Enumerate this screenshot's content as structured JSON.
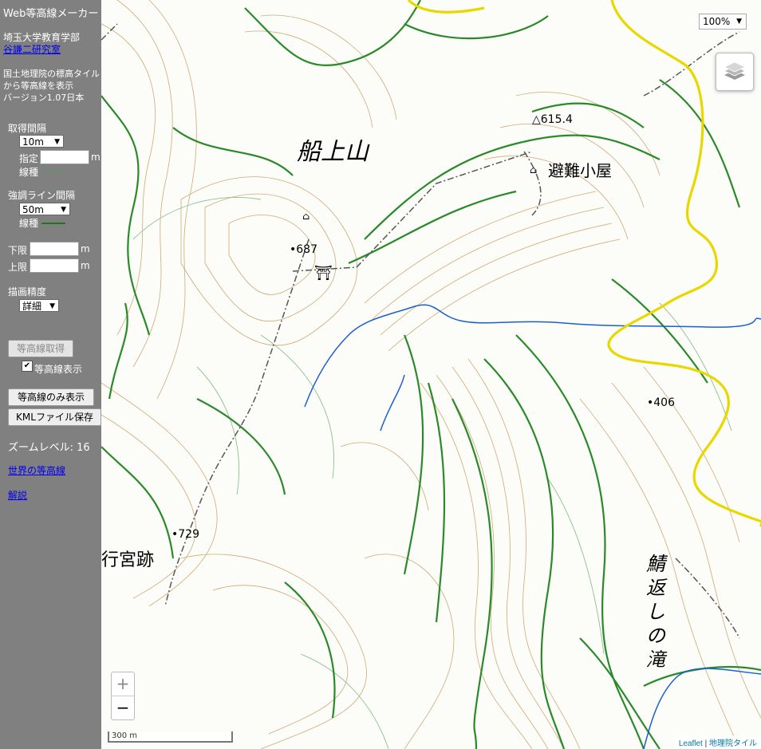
{
  "sidebar": {
    "app_title": "Web等高線メーカー",
    "org": "埼玉大学教育学部",
    "lab_link": "谷謙二研究室",
    "desc_line1": "国土地理院の標高タイル",
    "desc_line2": "から等高線を表示",
    "version": "バージョン1.07日本",
    "interval_label": "取得間隔",
    "interval_value": "10m",
    "custom_label": "指定",
    "unit_m": "m",
    "line_type_label": "線種",
    "emphasis_label": "強調ライン間隔",
    "emphasis_value": "50m",
    "lower_label": "下限",
    "upper_label": "上限",
    "precision_label": "描画精度",
    "precision_value": "詳細",
    "fetch_button": "等高線取得",
    "show_contours_label": "等高線表示",
    "contours_only_button": "等高線のみ表示",
    "kml_button": "KMLファイル保存",
    "zoom_level_text": "ズームレベル: 16",
    "world_link": "世界の等高線",
    "help_link": "解説",
    "colors": {
      "sidebar_bg": "#808080",
      "contour": "#2e8b57",
      "emphasis": "#1a7a1a"
    }
  },
  "map": {
    "labels": {
      "mountain": "船上山",
      "hut": "避難小屋",
      "peak_615": "△615.4",
      "spot_687": "687",
      "spot_729": "729",
      "spot_406": "406",
      "ruins": "行宮跡",
      "waterfall": "鯖返しの滝"
    },
    "zoom_select": "100%",
    "zoom_in": "+",
    "zoom_out": "−",
    "scale": "300 m",
    "attribution_leaflet": "Leaflet",
    "attribution_sep": " | ",
    "attribution_gsi": "地理院タイル",
    "icons": [
      "layers-icon",
      "shrine-icon",
      "hut-icon"
    ]
  }
}
